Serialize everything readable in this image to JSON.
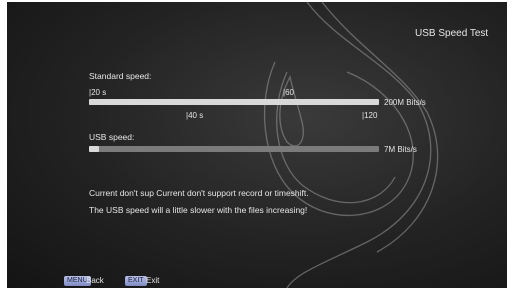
{
  "screen": {
    "title": "USB Speed Test"
  },
  "standard": {
    "label": "Standard speed:",
    "ticks": [
      "|20 s",
      "|60",
      "|40 s",
      "|120"
    ],
    "value_text": "200M Bits/s",
    "progress": 1.0
  },
  "usb": {
    "label": "USB speed:",
    "value_text": "7M Bits/s",
    "progress": 0.035
  },
  "messages": [
    "Current don't sup Current don't support record or timeshift.",
    "The USB speed will a little slower with the files increasing!"
  ],
  "footer": {
    "menu_key": "MENU",
    "menu_label": "Back",
    "exit_key": "EXIT",
    "exit_label": "Exit"
  },
  "colors": {
    "key_bg": "#8a93cc",
    "bar_fill": "#d9d9d9",
    "bar_track": "#7b7b7b"
  }
}
